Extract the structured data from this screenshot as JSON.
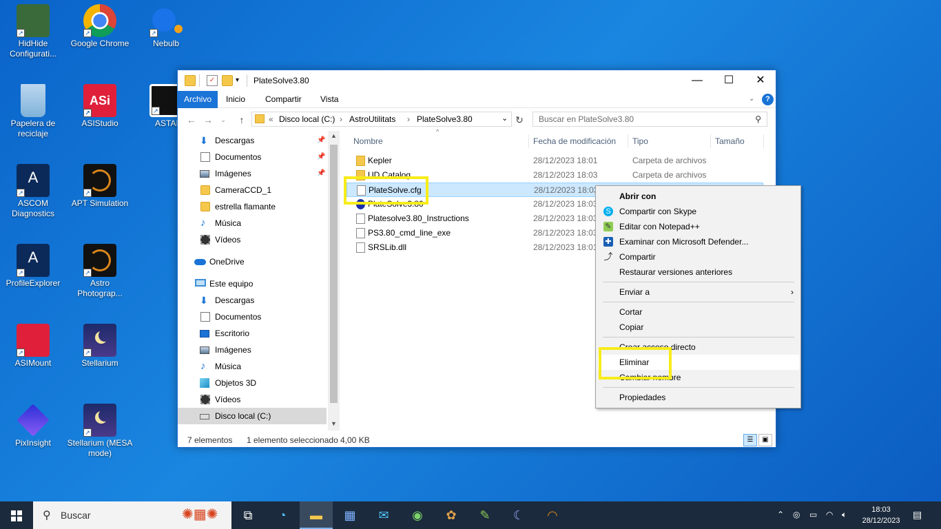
{
  "desktop": {
    "icons": [
      {
        "label": "HidHide Configurati...",
        "color": "#3a6a3a"
      },
      {
        "label": "Google Chrome",
        "color": "#db4437"
      },
      {
        "label": "Nebulb",
        "color": "#1a73e8"
      },
      {
        "label": "Papelera de reciclaje",
        "color": "#7fb2d9"
      },
      {
        "label": "ASIStudio",
        "color": "#e01f3a"
      },
      {
        "label": "ASTAP",
        "color": "#111111"
      },
      {
        "label": "ASCOM Diagnostics",
        "color": "#0b2a5a"
      },
      {
        "label": "APT Simulation",
        "color": "#111111"
      },
      {
        "label": "ProfileExplorer",
        "color": "#0b2a5a"
      },
      {
        "label": "Astro Photograp...",
        "color": "#111111"
      },
      {
        "label": "ASIMount",
        "color": "#e01f3a"
      },
      {
        "label": "Stellarium",
        "color": "#1d2a6a"
      },
      {
        "label": "PixInsight",
        "color": "#5a3cd6"
      },
      {
        "label": "Stellarium (MESA mode)",
        "color": "#1d2a6a"
      }
    ]
  },
  "window": {
    "title": "PlateSolve3.80",
    "controls": {
      "minimize": "—",
      "maximize": "☐",
      "close": "✕"
    },
    "ribbon_tabs": [
      "Archivo",
      "Inicio",
      "Compartir",
      "Vista"
    ],
    "help": "?",
    "address": {
      "prefix": "«",
      "crumbs": [
        "Disco local (C:)",
        "AstroUtilitats",
        "PlateSolve3.80"
      ],
      "sep": "›"
    },
    "search_placeholder": "Buscar en PlateSolve3.80",
    "nav": {
      "quick_access": [
        {
          "label": "Descargas",
          "pinned": true
        },
        {
          "label": "Documentos",
          "pinned": true
        },
        {
          "label": "Imágenes",
          "pinned": true
        },
        {
          "label": "CameraCCD_1",
          "pinned": false
        },
        {
          "label": "estrella flamante",
          "pinned": false
        },
        {
          "label": "Música",
          "pinned": false
        },
        {
          "label": "Vídeos",
          "pinned": false
        }
      ],
      "onedrive": "OneDrive",
      "this_pc": "Este equipo",
      "pc_items": [
        "Descargas",
        "Documentos",
        "Escritorio",
        "Imágenes",
        "Música",
        "Objetos 3D",
        "Vídeos",
        "Disco local (C:)"
      ]
    },
    "columns": [
      "Nombre",
      "Fecha de modificación",
      "Tipo",
      "Tamaño"
    ],
    "files": [
      {
        "name": "Kepler",
        "date": "28/12/2023 18:01",
        "type": "Carpeta de archivos",
        "icon": "folder"
      },
      {
        "name": "UD Catalog",
        "date": "28/12/2023 18:03",
        "type": "Carpeta de archivos",
        "icon": "folder"
      },
      {
        "name": "PlateSolve.cfg",
        "date": "28/12/2023 18:03",
        "type": "",
        "icon": "file",
        "selected": true
      },
      {
        "name": "PlateSolve3.80",
        "date": "28/12/2023 18:03",
        "type": "",
        "icon": "exe"
      },
      {
        "name": "Platesolve3.80_Instructions",
        "date": "28/12/2023 18:03",
        "type": "",
        "icon": "file"
      },
      {
        "name": "PS3.80_cmd_line_exe",
        "date": "28/12/2023 18:03",
        "type": "",
        "icon": "file"
      },
      {
        "name": "SRSLib.dll",
        "date": "28/12/2023 18:01",
        "type": "",
        "icon": "file"
      }
    ],
    "status": {
      "count": "7 elementos",
      "selection": "1 elemento seleccionado",
      "size": "4,00 KB"
    }
  },
  "context_menu": {
    "items": [
      {
        "label": "Abrir con",
        "bold": true
      },
      {
        "label": "Compartir con Skype",
        "icon": "skype-icon"
      },
      {
        "label": "Editar con Notepad++",
        "icon": "notepadpp-icon"
      },
      {
        "label": "Examinar con Microsoft Defender...",
        "icon": "defender-icon"
      },
      {
        "label": "Compartir",
        "icon": "share-icon"
      },
      {
        "label": "Restaurar versiones anteriores"
      },
      {
        "label": "Enviar a",
        "submenu": true
      },
      {
        "label": "Cortar"
      },
      {
        "label": "Copiar"
      },
      {
        "label": "Crear acceso directo"
      },
      {
        "label": "Eliminar",
        "highlighted": true
      },
      {
        "label": "Cambiar nombre"
      },
      {
        "label": "Propiedades"
      }
    ]
  },
  "taskbar": {
    "search_text": "Buscar",
    "time": "18:03",
    "date": "28/12/2023"
  }
}
